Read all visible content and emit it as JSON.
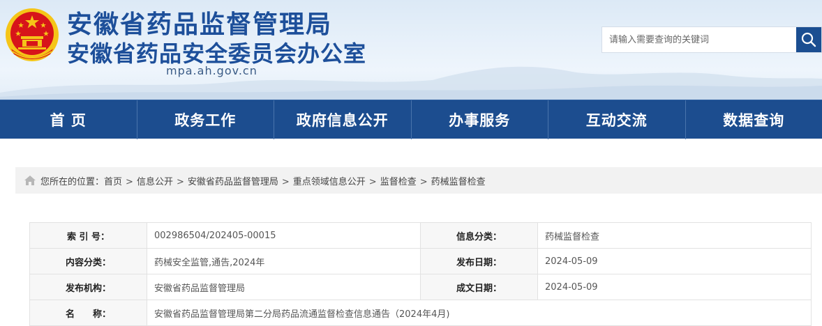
{
  "header": {
    "title_line1": "安徽省药品监督管理局",
    "title_line2": "安徽省药品安全委员会办公室",
    "domain": "mpa.ah.gov.cn",
    "emblem_icon": "national-emblem-icon"
  },
  "search": {
    "placeholder": "请输入需要查询的关键词",
    "button_icon": "search-icon"
  },
  "nav": {
    "items": [
      {
        "label": "首 页"
      },
      {
        "label": "政务工作"
      },
      {
        "label": "政府信息公开"
      },
      {
        "label": "办事服务"
      },
      {
        "label": "互动交流"
      },
      {
        "label": "数据查询"
      }
    ]
  },
  "breadcrumb": {
    "icon": "home-icon",
    "prefix": "您所在的位置：",
    "items": [
      "首页",
      "信息公开",
      "安徽省药品监督管理局",
      "重点领域信息公开",
      "监督检查",
      "药械监督检查"
    ],
    "separator": ">"
  },
  "info": {
    "index_label": "索 引 号：",
    "index_value": "002986504/202405-00015",
    "category_label": "信息分类：",
    "category_value": "药械监督检查",
    "content_label": "内容分类：",
    "content_value": "药械安全监管,通告,2024年",
    "publish_label": "发布日期：",
    "publish_value": "2024-05-09",
    "org_label": "发布机构：",
    "org_value": "安徽省药品监督管理局",
    "created_label": "成文日期：",
    "created_value": "2024-05-09",
    "name_label": "名　　称：",
    "name_value": "安徽省药品监督管理局第二分局药品流通监督检查信息通告（2024年4月)"
  },
  "colors": {
    "brand_blue": "#1c4d8f",
    "title_blue": "#1d4f9a",
    "emblem_red": "#d7141a",
    "emblem_gold": "#f5c518"
  }
}
